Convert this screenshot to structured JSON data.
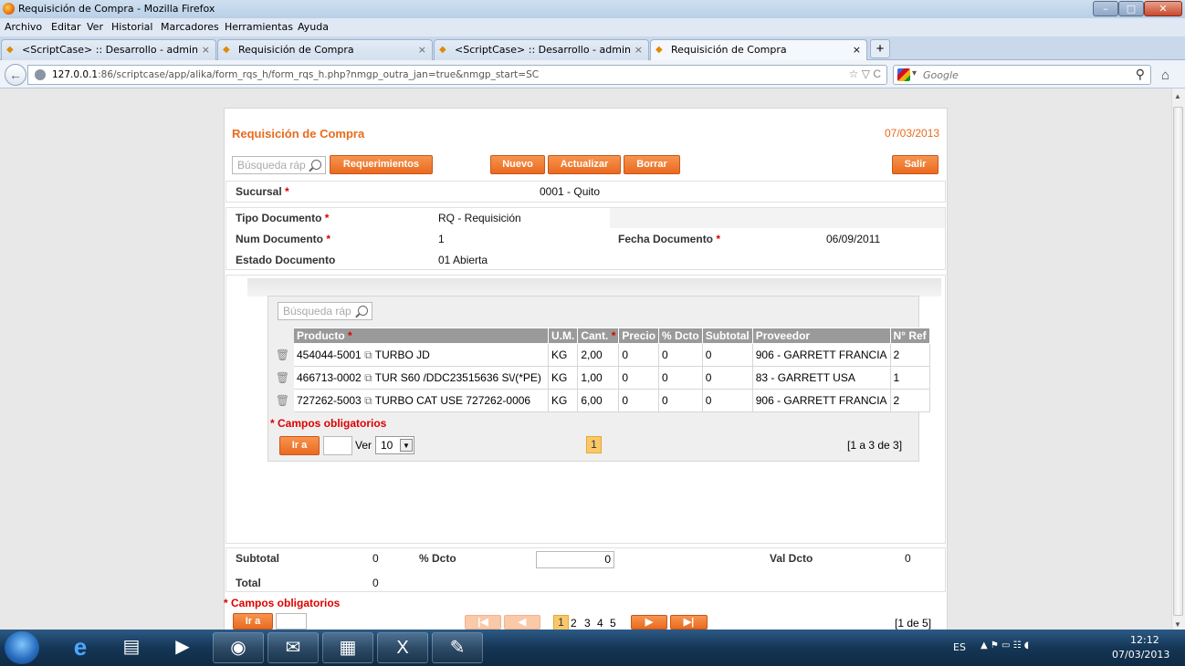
{
  "window": {
    "title": "Requisición de Compra - Mozilla Firefox",
    "controls": [
      "–",
      "□",
      "✕"
    ]
  },
  "menu": [
    "Archivo",
    "Editar",
    "Ver",
    "Historial",
    "Marcadores",
    "Herramientas",
    "Ayuda"
  ],
  "tabs": [
    {
      "label": "<ScriptCase> :: Desarrollo - admin",
      "active": false
    },
    {
      "label": "Requisición de Compra",
      "active": false
    },
    {
      "label": "<ScriptCase> :: Desarrollo - admin",
      "active": false
    },
    {
      "label": "Requisición de Compra",
      "active": true
    }
  ],
  "new_tab": "+",
  "tab_close": "×",
  "nav": {
    "url_host": "127.0.0.1",
    "url_rest": ":86/scriptcase/app/alika/form_rqs_h/form_rqs_h.php?nmgp_outra_jan=true&nmgp_start=SC",
    "url_icons": "☆ ▽ C",
    "search_placeholder": "Google",
    "search_dropdown": "▾",
    "search_go": "⚲",
    "back": "←",
    "home": "⌂"
  },
  "form": {
    "title": "Requisición de Compra",
    "date": "07/03/2013",
    "quick_search": "Búsqueda ráp",
    "buttons": {
      "requerimientos": "Requerimientos",
      "nuevo": "Nuevo",
      "actualizar": "Actualizar",
      "borrar": "Borrar",
      "salir": "Salir"
    },
    "sucursal": {
      "label": "Sucursal",
      "value": "0001 - Quito"
    },
    "tipo_documento": {
      "label": "Tipo Documento",
      "value": "RQ - Requisición"
    },
    "num_documento": {
      "label": "Num Documento",
      "value": "1"
    },
    "fecha_documento": {
      "label": "Fecha Documento",
      "value": "06/09/2011"
    },
    "estado_documento": {
      "label": "Estado Documento",
      "value": "01 Abierta"
    },
    "required_mark": "*"
  },
  "detail": {
    "quick_search": "Búsqueda ráp",
    "columns": [
      "Producto",
      "U.M.",
      "Cant.",
      "Precio",
      "% Dcto",
      "Subtotal",
      "Proveedor",
      "N° Ref"
    ],
    "rows": [
      {
        "code": "454044-5001",
        "desc": "TURBO JD",
        "um": "KG",
        "cant": "2,00",
        "precio": "0",
        "dcto": "0",
        "subtotal": "0",
        "proveedor": "906 - GARRETT FRANCIA",
        "ref": "2"
      },
      {
        "code": "466713-0002",
        "desc": "TUR S60 /DDC23515636 S\\/(*PE)",
        "um": "KG",
        "cant": "1,00",
        "precio": "0",
        "dcto": "0",
        "subtotal": "0",
        "proveedor": "83 - GARRETT USA",
        "ref": "1"
      },
      {
        "code": "727262-5003",
        "desc": "TURBO CAT USE 727262-0006",
        "um": "KG",
        "cant": "6,00",
        "precio": "0",
        "dcto": "0",
        "subtotal": "0",
        "proveedor": "906 - GARRETT FRANCIA",
        "ref": "2"
      }
    ],
    "required_note": "* Campos obligatorios",
    "goto_label": "Ir a",
    "ver_label": "Ver",
    "ver_value": "10",
    "current_page": "1",
    "range": "[1 a 3 de 3]"
  },
  "totals": {
    "subtotal_label": "Subtotal",
    "subtotal_value": "0",
    "dcto_label": "% Dcto",
    "dcto_value": "0",
    "val_dcto_label": "Val Dcto",
    "val_dcto_value": "0",
    "total_label": "Total",
    "total_value": "0"
  },
  "footer": {
    "required_note": "* Campos obligatorios",
    "goto_label": "Ir a",
    "pages": [
      "1",
      "2",
      "3",
      "4",
      "5"
    ],
    "range": "[1 de 5]"
  },
  "taskbar": {
    "lang": "ES",
    "time": "12:12",
    "date": "07/03/2013"
  }
}
